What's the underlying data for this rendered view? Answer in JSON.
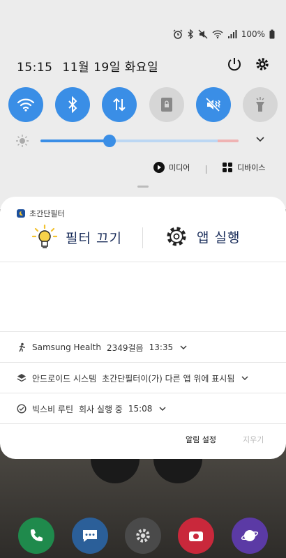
{
  "status_bar": {
    "battery": "100%"
  },
  "header": {
    "time": "15:15",
    "date": "11월 19일 화요일"
  },
  "quick_tiles": [
    {
      "name": "wifi",
      "state": "on"
    },
    {
      "name": "bluetooth",
      "state": "on"
    },
    {
      "name": "mobile-data",
      "state": "on"
    },
    {
      "name": "screen-lock",
      "state": "off"
    },
    {
      "name": "vibrate",
      "state": "on"
    },
    {
      "name": "flashlight",
      "state": "off"
    }
  ],
  "brightness": {
    "level": 0.35
  },
  "media_row": {
    "media_label": "미디어",
    "devices_label": "디바이스"
  },
  "notification": {
    "app_name": "초간단필터",
    "action_filter_off": "필터 끄기",
    "action_run_app": "앱 실행"
  },
  "notifications": [
    {
      "app": "Samsung Health",
      "text": "2349걸음",
      "time": "13:35"
    },
    {
      "app": "안드로이드 시스템",
      "text": "초간단필터이(가) 다른 앱 위에 표시됨",
      "time": ""
    },
    {
      "app": "빅스비 루틴",
      "text": "회사 실행 중",
      "time": "15:08"
    }
  ],
  "footer": {
    "alarm_settings": "알림 설정",
    "clear": "지우기"
  },
  "colors": {
    "accent": "#3a8ee6",
    "tile_off": "#d6d6d6",
    "panel_bg": "#ececec"
  }
}
